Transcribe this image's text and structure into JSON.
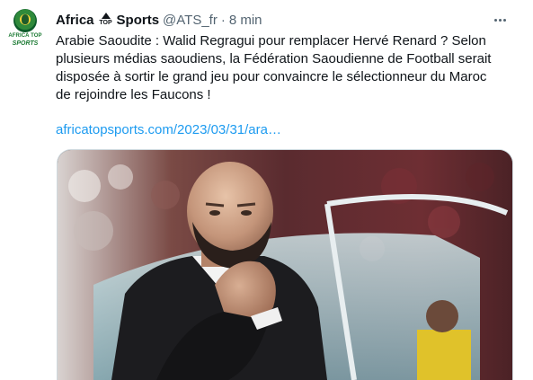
{
  "tweet": {
    "avatar": {
      "caption_line1": "AFRICA TOP",
      "caption_line2": "SPORTS"
    },
    "header": {
      "name_part1": "Africa",
      "logo_text": "TOP",
      "name_part2": "Sports",
      "handle": "@ATS_fr",
      "separator": "·",
      "time": "8 min"
    },
    "text": "Arabie Saoudite : Walid Regragui pour remplacer Hervé Renard ? Selon plusieurs médias saoudiens, la Fédération Saoudienne de Football serait disposée à sortir le grand jeu pour convaincre le sélectionneur du Maroc de rejoindre les Faucons !",
    "link": "africatopsports.com/2023/03/31/ara…"
  },
  "colors": {
    "link": "#1d9bf0",
    "text": "#0f1419",
    "secondary": "#536471",
    "brand_green": "#1b7a33"
  },
  "icons": {
    "more": "more-horizontal-icon",
    "logo": "top-logo-icon"
  }
}
